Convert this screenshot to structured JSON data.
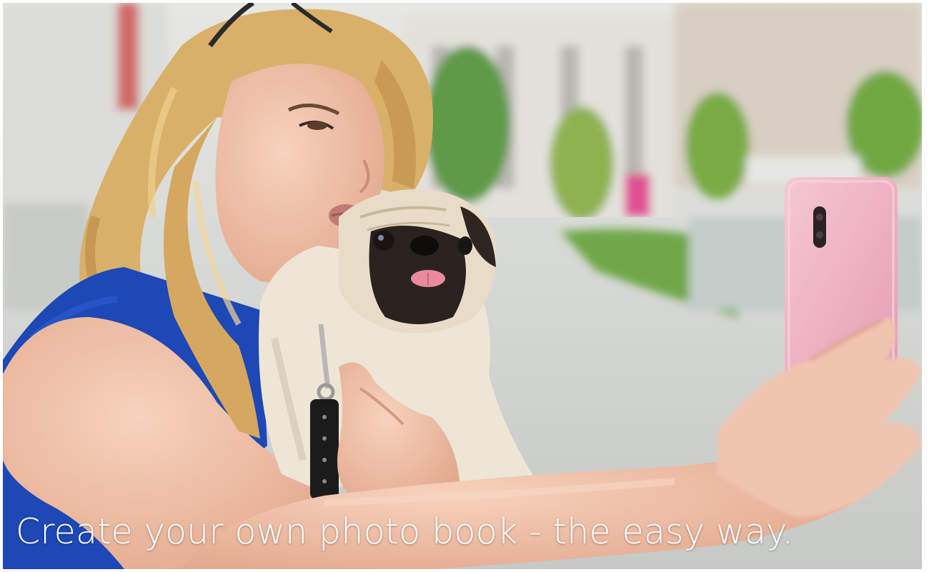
{
  "banner": {
    "headline": "Create your own photo book - the easy way."
  },
  "colors": {
    "dress": "#1d48b5",
    "hair": "#d9b06a",
    "skin": "#f2c4ae",
    "pug_fur": "#eee5d6",
    "pug_face": "#2a221f",
    "phone": "#f0b3c3",
    "background": "#cfd2cf"
  }
}
